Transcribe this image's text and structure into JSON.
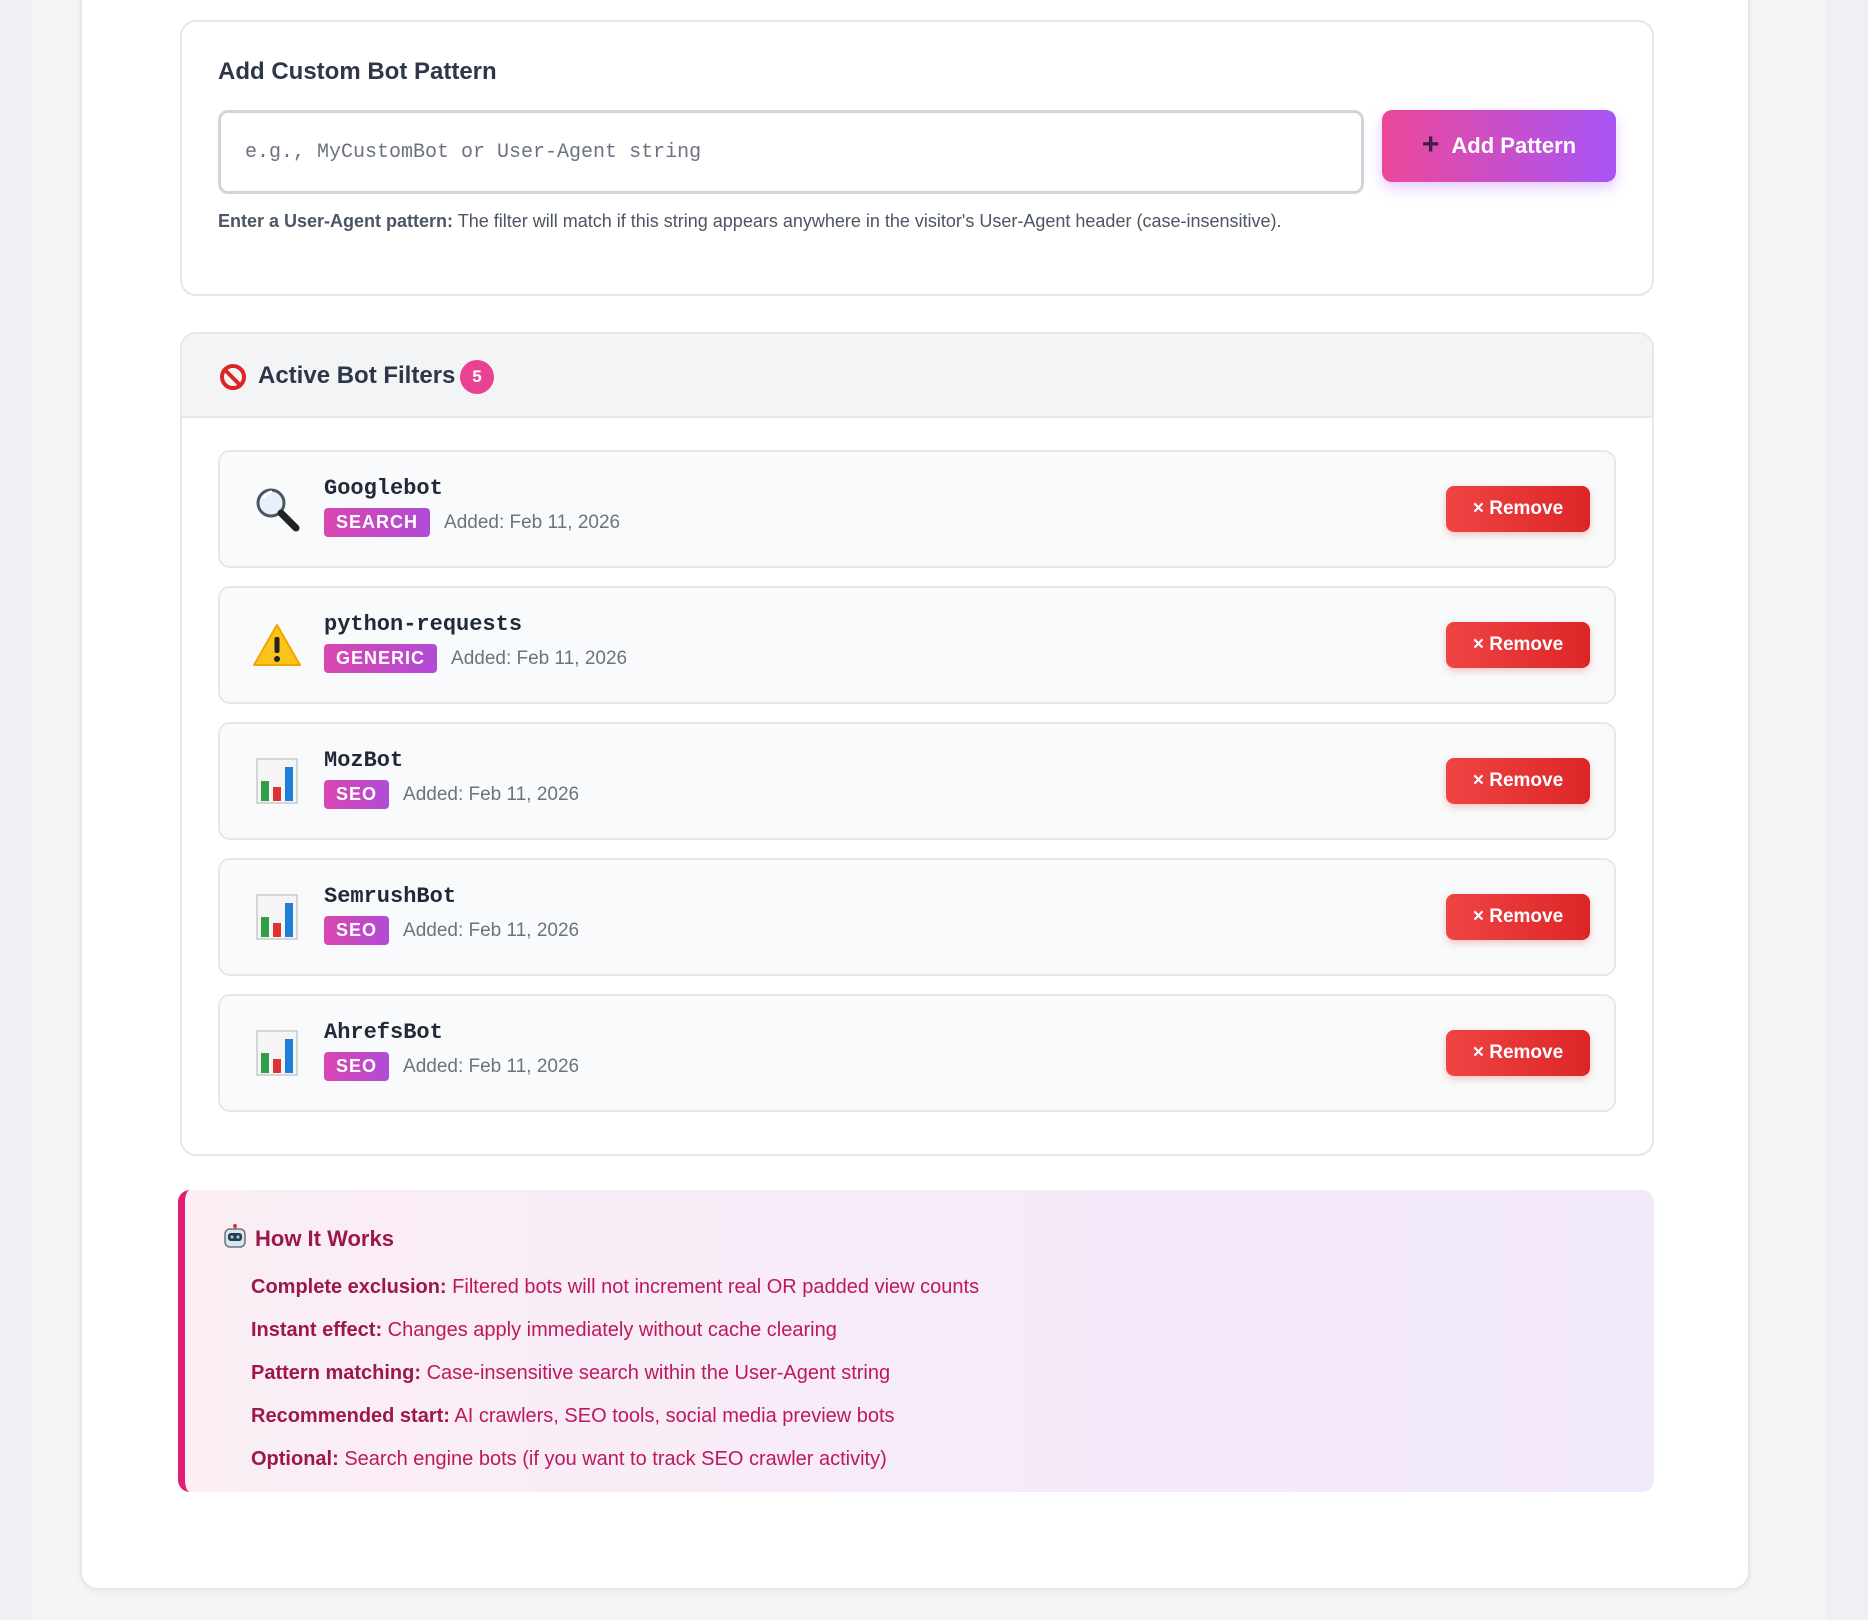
{
  "add_pattern": {
    "title": "Add Custom Bot Pattern",
    "input_placeholder": "e.g., MyCustomBot or User-Agent string",
    "input_value": "",
    "button_label": "Add Pattern",
    "hint_bold": "Enter a User-Agent pattern:",
    "hint_text": " The filter will match if this string appears anywhere in the visitor's User-Agent header (case-insensitive)."
  },
  "active_filters": {
    "title": "Active Bot Filters",
    "count": "5",
    "remove_label": "× Remove",
    "items": [
      {
        "name": "Googlebot",
        "category": "SEARCH",
        "added": "Added: Feb 11, 2026",
        "icon": "magnifier-icon"
      },
      {
        "name": "python-requests",
        "category": "GENERIC",
        "added": "Added: Feb 11, 2026",
        "icon": "warning-icon"
      },
      {
        "name": "MozBot",
        "category": "SEO",
        "added": "Added: Feb 11, 2026",
        "icon": "bar-chart-icon"
      },
      {
        "name": "SemrushBot",
        "category": "SEO",
        "added": "Added: Feb 11, 2026",
        "icon": "bar-chart-icon"
      },
      {
        "name": "AhrefsBot",
        "category": "SEO",
        "added": "Added: Feb 11, 2026",
        "icon": "bar-chart-icon"
      }
    ]
  },
  "how_it_works": {
    "title": "How It Works",
    "items": [
      {
        "label": "Complete exclusion:",
        "text": " Filtered bots will not increment real OR padded view counts"
      },
      {
        "label": "Instant effect:",
        "text": " Changes apply immediately without cache clearing"
      },
      {
        "label": "Pattern matching:",
        "text": " Case-insensitive search within the User-Agent string"
      },
      {
        "label": "Recommended start:",
        "text": " AI crawlers, SEO tools, social media preview bots"
      },
      {
        "label": "Optional:",
        "text": " Search engine bots (if you want to track SEO crawler activity)"
      }
    ]
  },
  "colors": {
    "accent_pink": "#ec4899",
    "accent_purple": "#a855f7",
    "danger_red": "#dc2626",
    "info_text": "#be185d"
  }
}
